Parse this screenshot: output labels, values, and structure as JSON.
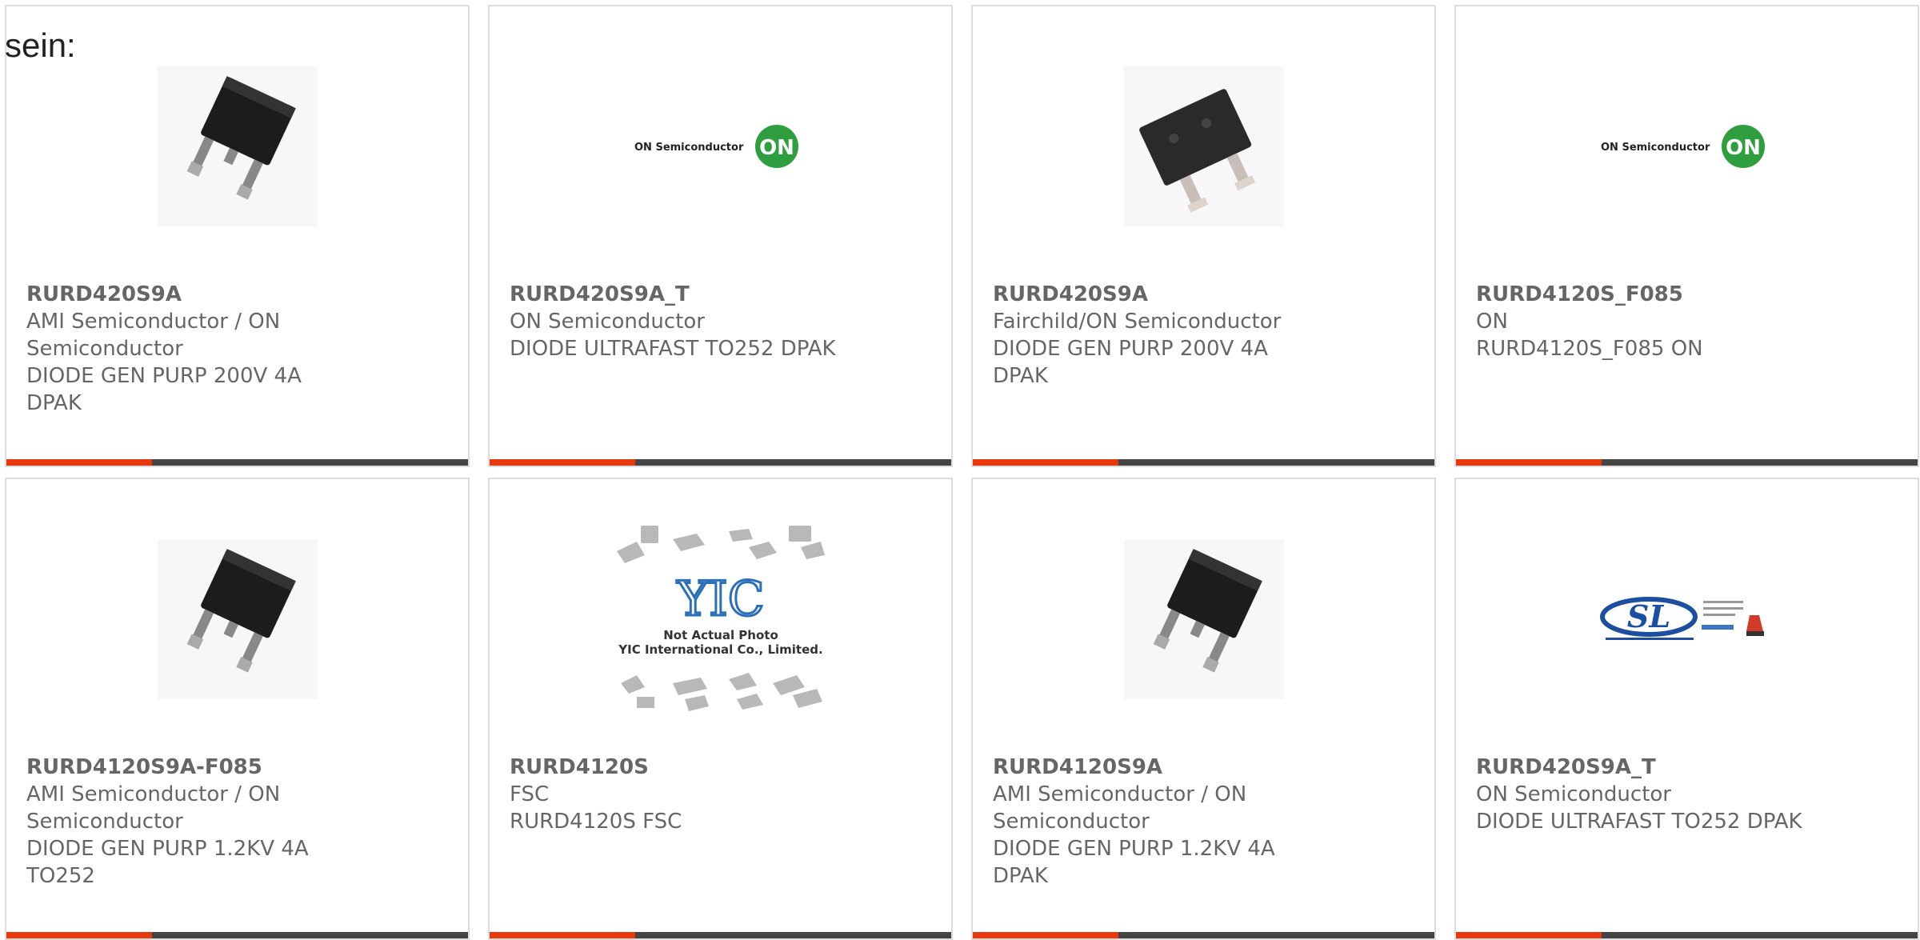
{
  "page": {
    "heading_fragment": "sein:"
  },
  "colors": {
    "accent_bar": "#e8380d",
    "bar": "#444444",
    "text": "#666666",
    "card_border": "#dddddd"
  },
  "products": [
    {
      "part_number": "RURD420S9A",
      "manufacturer": "AMI Semiconductor / ON Semiconductor",
      "description": "DIODE GEN PURP 200V 4A DPAK",
      "image": "dpak-package-photo"
    },
    {
      "part_number": "RURD420S9A_T",
      "manufacturer": "ON Semiconductor",
      "description": "DIODE ULTRAFAST TO252 DPAK",
      "image": "on-semiconductor-logo",
      "logo_text": "ON Semiconductor",
      "logo_badge": "ON"
    },
    {
      "part_number": "RURD420S9A",
      "manufacturer": "Fairchild/ON Semiconductor",
      "description": "DIODE GEN PURP 200V 4A DPAK",
      "image": "dpak-package-photo-angled"
    },
    {
      "part_number": "RURD4120S_F085",
      "manufacturer": "ON",
      "description": "RURD4120S_F085 ON",
      "image": "on-semiconductor-logo",
      "logo_text": "ON Semiconductor",
      "logo_badge": "ON"
    },
    {
      "part_number": "RURD4120S9A-F085",
      "manufacturer": "AMI Semiconductor / ON Semiconductor",
      "description": "DIODE GEN PURP 1.2KV 4A TO252",
      "image": "dpak-package-photo"
    },
    {
      "part_number": "RURD4120S",
      "manufacturer": "FSC",
      "description": "RURD4120S FSC",
      "image": "yic-placeholder",
      "placeholder_line1": "Not Actual Photo",
      "placeholder_line2": "YIC International Co., Limited.",
      "placeholder_logo": "YIC"
    },
    {
      "part_number": "RURD4120S9A",
      "manufacturer": "AMI Semiconductor / ON Semiconductor",
      "description": "DIODE GEN PURP 1.2KV 4A DPAK",
      "image": "dpak-package-photo"
    },
    {
      "part_number": "RURD420S9A_T",
      "manufacturer": "ON Semiconductor",
      "description": "DIODE ULTRAFAST TO252 DPAK",
      "image": "sl-power-electronics-logo",
      "logo_text": "SL"
    }
  ]
}
